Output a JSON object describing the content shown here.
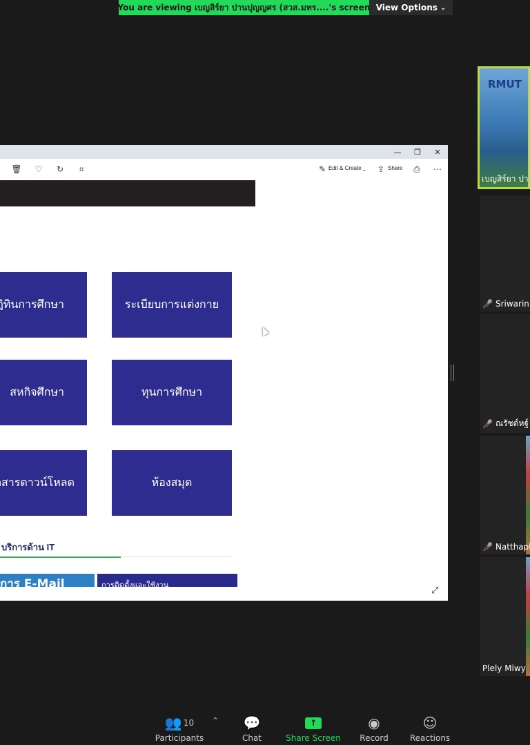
{
  "banner": {
    "viewing_text": "You are viewing เบญสิร์ยา ปานปุญญศร (สวส.มทร....'s screen",
    "view_options": "View Options",
    "chevron": "⌄"
  },
  "window": {
    "toolbar": {
      "edit_create": "Edit & Create",
      "share": "Share"
    },
    "tiles": [
      "ฏิทินการศึกษา",
      "ระเบียบการแต่งกาย",
      "สหกิจศึกษา",
      "ทุนการศึกษา",
      "กสารดาวน์โหลด",
      "ห้องสมุด"
    ],
    "it_section": "บริการด้าน IT",
    "banner_left": "การ E-Mail",
    "banner_right": "การติดตั้งและใช้งาน"
  },
  "participants": [
    {
      "name": "เบญสิร์ยา ปาน",
      "muted": false,
      "has_logo": true,
      "logo_text": "RMUT"
    },
    {
      "name": "Sriwarin",
      "muted": true
    },
    {
      "name": "ณรัชต์หฐ์",
      "muted": true
    },
    {
      "name": "Natthaph",
      "muted": true
    },
    {
      "name": "Plely Miwy",
      "muted": false
    }
  ],
  "controls": {
    "participants_label": "Participants",
    "participants_count": "10",
    "chat_label": "Chat",
    "share_label": "Share Screen",
    "record_label": "Record",
    "reactions_label": "Reactions"
  },
  "colors": {
    "share_green": "#23d95a",
    "tile_blue": "#2e2d8f",
    "muted_red": "#e04848",
    "active_border": "#b9d84b"
  }
}
